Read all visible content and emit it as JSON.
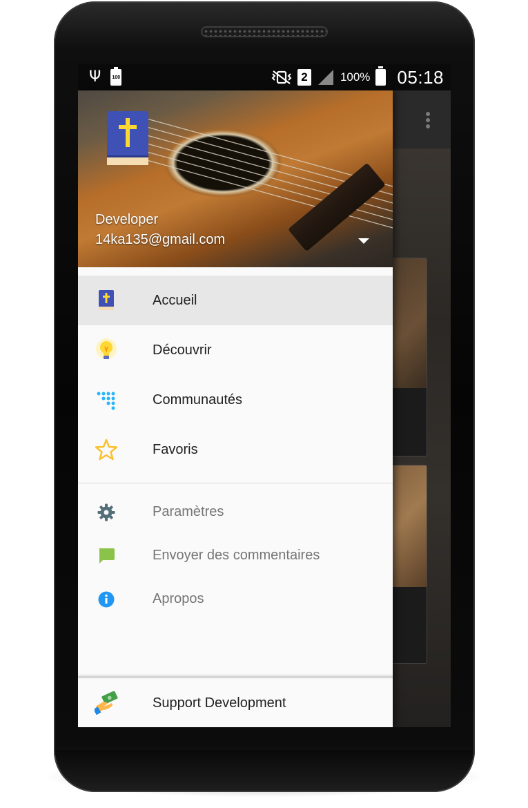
{
  "status_bar": {
    "battery_small_text": "100",
    "sim_slot": "2",
    "battery_percent": "100%",
    "time": "05:18"
  },
  "drawer": {
    "header": {
      "account_name": "Developer",
      "account_email": "14ka135@gmail.com"
    },
    "primary_items": [
      {
        "label": "Accueil",
        "icon": "bible-book-icon",
        "active": true
      },
      {
        "label": "Découvrir",
        "icon": "lightbulb-icon",
        "active": false
      },
      {
        "label": "Communautés",
        "icon": "dots-grid-icon",
        "active": false
      },
      {
        "label": "Favoris",
        "icon": "star-icon",
        "active": false
      }
    ],
    "secondary_items": [
      {
        "label": "Paramètres",
        "icon": "gear-icon"
      },
      {
        "label": "Envoyer des commentaires",
        "icon": "feedback-icon"
      },
      {
        "label": "Apropos",
        "icon": "info-icon"
      }
    ],
    "footer_item": {
      "label": "Support Development",
      "icon": "money-hand-icon"
    }
  },
  "colors": {
    "active_item_bg": "#e7e7e7",
    "drawer_bg": "#fafafa",
    "primary_text": "#212121",
    "secondary_text": "#757575",
    "accent_blue": "#29b6f6",
    "star_yellow": "#fbc02d",
    "gear_gray": "#546e7a",
    "feedback_green": "#8bc34a",
    "info_blue": "#2196f3",
    "fab_green": "#2f6b59"
  }
}
